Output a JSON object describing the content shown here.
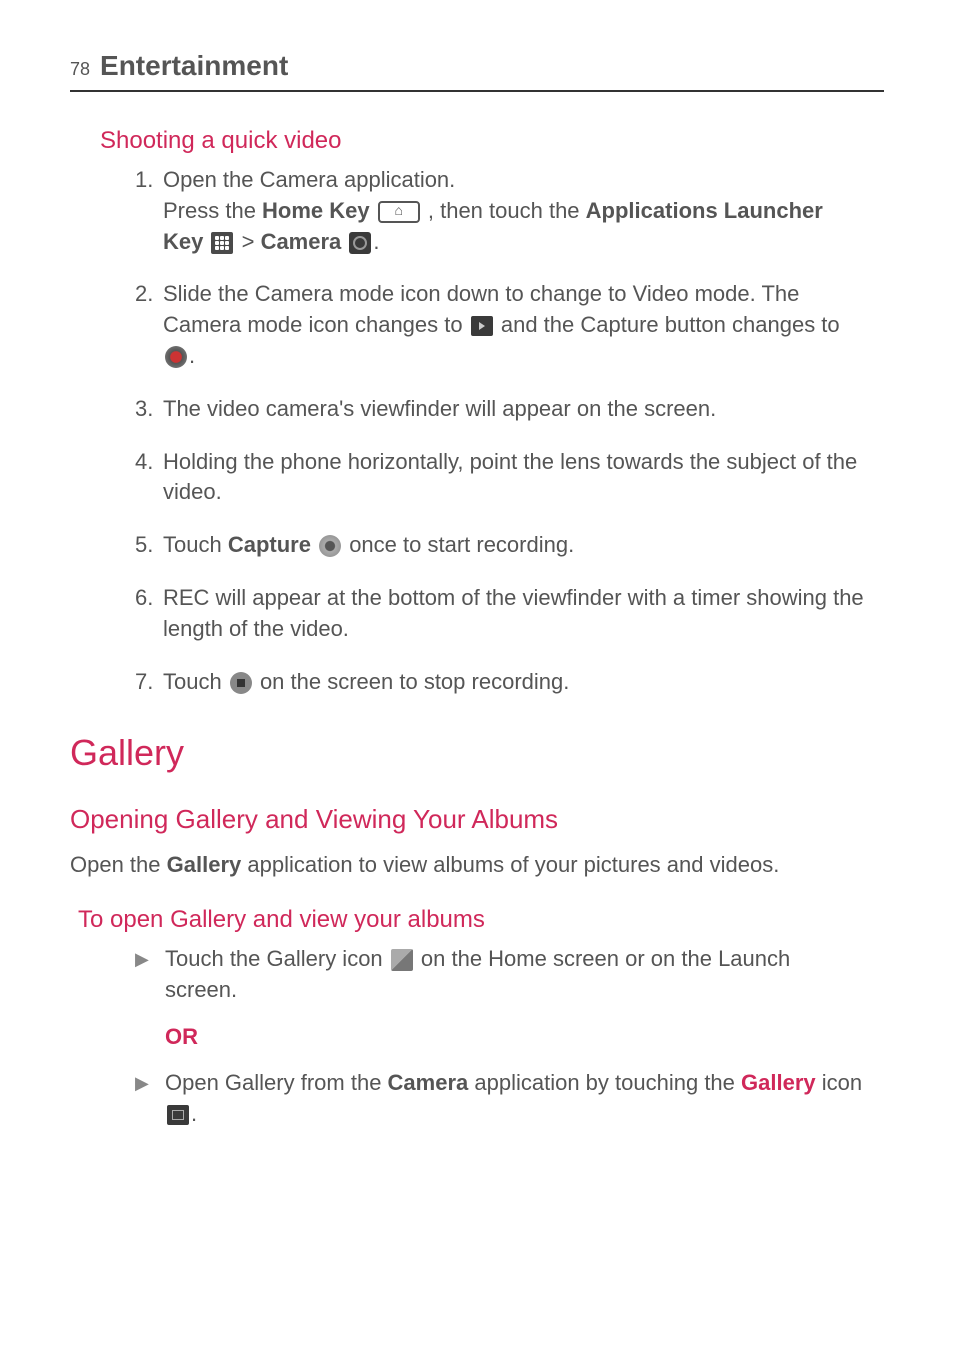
{
  "header": {
    "page_number": "78",
    "section": "Entertainment"
  },
  "shooting": {
    "heading": "Shooting a quick video",
    "steps": {
      "s1_num": "1.",
      "s1_a": "Open the Camera application.",
      "s1_b1": "Press the ",
      "s1_home": "Home Key ",
      "s1_b2": " , then touch the ",
      "s1_apps": "Applications Launcher Key ",
      "s1_b3": " > ",
      "s1_cam": "Camera ",
      "s1_b4": ".",
      "s2_num": "2.",
      "s2_a": "Slide the Camera mode icon down to change to Video mode. The Camera mode icon changes to ",
      "s2_b": " and the Capture button changes to ",
      "s2_c": ".",
      "s3_num": "3.",
      "s3": "The video camera's viewfinder will appear on the screen.",
      "s4_num": "4.",
      "s4": "Holding the phone horizontally, point the lens towards the subject of the video.",
      "s5_num": "5.",
      "s5_a": "Touch ",
      "s5_cap": "Capture ",
      "s5_b": " once to start recording.",
      "s6_num": "6.",
      "s6": "REC will appear at the bottom of the viewfinder with a timer showing the length of the video.",
      "s7_num": "7.",
      "s7_a": "Touch ",
      "s7_b": " on the screen to stop recording."
    }
  },
  "gallery": {
    "heading": "Gallery",
    "subheading": "Opening Gallery and Viewing Your Albums",
    "intro_a": "Open the ",
    "intro_gallery": "Gallery",
    "intro_b": " application to view albums of your pictures and videos.",
    "open_heading": "To open Gallery and view your albums",
    "b1_a": "Touch the Gallery icon ",
    "b1_b": " on the Home screen or on the Launch screen.",
    "or": "OR",
    "b2_a": "Open Gallery from the ",
    "b2_cam": "Camera",
    "b2_b": " application by touching the ",
    "b2_gal": "Gallery",
    "b2_c": " icon ",
    "b2_d": "."
  }
}
